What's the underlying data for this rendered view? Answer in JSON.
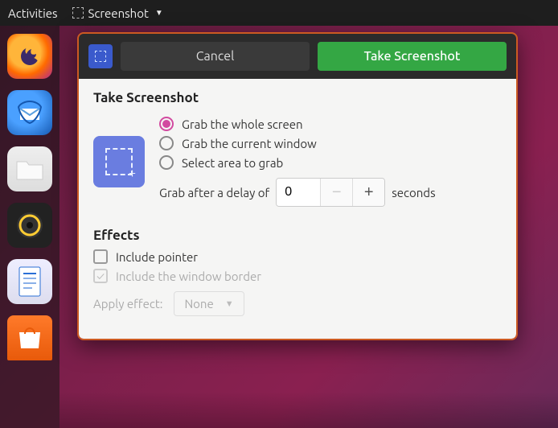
{
  "topbar": {
    "activities": "Activities",
    "app_name": "Screenshot"
  },
  "dialog": {
    "cancel": "Cancel",
    "take": "Take Screenshot",
    "title": "Take Screenshot",
    "opt_whole": "Grab the whole screen",
    "opt_window": "Grab the current window",
    "opt_area": "Select area to grab",
    "delay_prefix": "Grab after a delay of",
    "delay_value": "0",
    "delay_suffix": "seconds"
  },
  "effects": {
    "title": "Effects",
    "include_pointer": "Include pointer",
    "include_border": "Include the window border",
    "apply_label": "Apply effect:",
    "apply_value": "None"
  }
}
